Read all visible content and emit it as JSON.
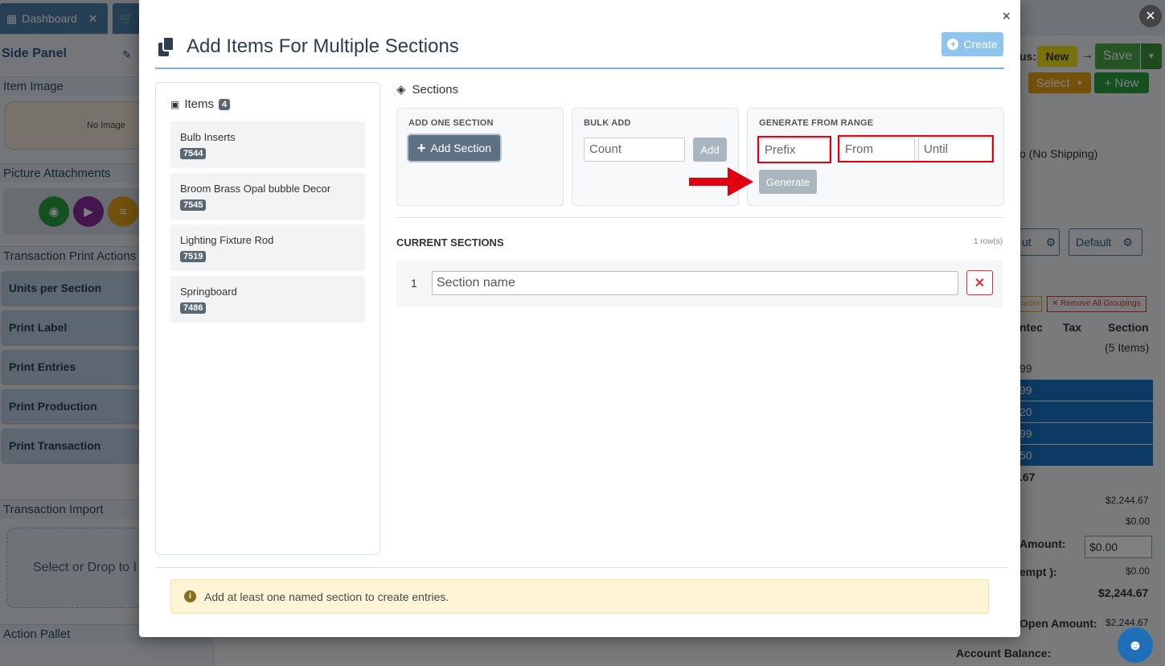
{
  "background": {
    "tabs": [
      {
        "label": "Dashboard",
        "close": "✕"
      }
    ],
    "side_panel": {
      "title": "Side Panel",
      "item_image_header": "Item Image",
      "no_image": "No Image",
      "picture_attachments_header": "Picture Attachments",
      "print_actions_header": "Transaction Print Actions",
      "buttons": [
        "Units per Section",
        "Print Label",
        "Print Entries",
        "Print Production",
        "Print Transaction"
      ],
      "import_header": "Transaction Import",
      "drop_text": "Select or Drop to I",
      "action_pallet_header": "Action Pallet"
    },
    "right": {
      "status_suffix": "us:",
      "status_badge": "New",
      "save_label": "Save",
      "select_label": "Select",
      "new_label": "New",
      "shipping_text": "o (No Shipping)",
      "layout_btn": "ut",
      "default_btn": "Default",
      "order_btn": "order",
      "remove_groupings": "Remove All Groupings",
      "col_entered": "ntec",
      "col_tax": "Tax",
      "col_section": "Section",
      "items_count": "(5 Items)",
      "row_values": [
        "99",
        "99",
        "20",
        "99",
        "50"
      ],
      "total_partial": ".67",
      "sum_lines": [
        {
          "label": "",
          "value": "$2,244.67"
        },
        {
          "label": "",
          "value": "$0.00"
        },
        {
          "label": "Amount:",
          "value": "$0.00"
        },
        {
          "label": "empt ):",
          "value": "$0.00"
        },
        {
          "label": "",
          "value": "$2,244.67"
        },
        {
          "label": "Open Amount:",
          "value": "$2,244.67"
        },
        {
          "label": "Account Balance:",
          "value": ""
        }
      ]
    }
  },
  "modal": {
    "title": "Add Items For Multiple Sections",
    "close": "×",
    "create_label": "Create",
    "items": {
      "header": "Items",
      "count": "4",
      "list": [
        {
          "name": "Bulb Inserts",
          "id": "7544"
        },
        {
          "name": "Broom Brass Opal bubble Decor",
          "id": "7545"
        },
        {
          "name": "Lighting Fixture Rod",
          "id": "7519"
        },
        {
          "name": "Springboard",
          "id": "7486"
        }
      ]
    },
    "sections_header": "Sections",
    "add_one": {
      "header": "ADD ONE SECTION",
      "button": "Add Section"
    },
    "bulk_add": {
      "header": "BULK ADD",
      "placeholder": "Count",
      "button": "Add"
    },
    "generate": {
      "header": "GENERATE FROM RANGE",
      "prefix_placeholder": "Prefix",
      "from_placeholder": "From",
      "until_placeholder": "Until",
      "button": "Generate"
    },
    "current": {
      "header": "CURRENT SECTIONS",
      "rows_label": "1 row(s)",
      "rows": [
        {
          "num": "1",
          "placeholder": "Section name"
        }
      ]
    },
    "alert": "Add at least one named section to create entries."
  },
  "colors": {
    "accent": "#5c7182",
    "highlight": "#e00010",
    "alert_bg": "#fff4d6"
  }
}
